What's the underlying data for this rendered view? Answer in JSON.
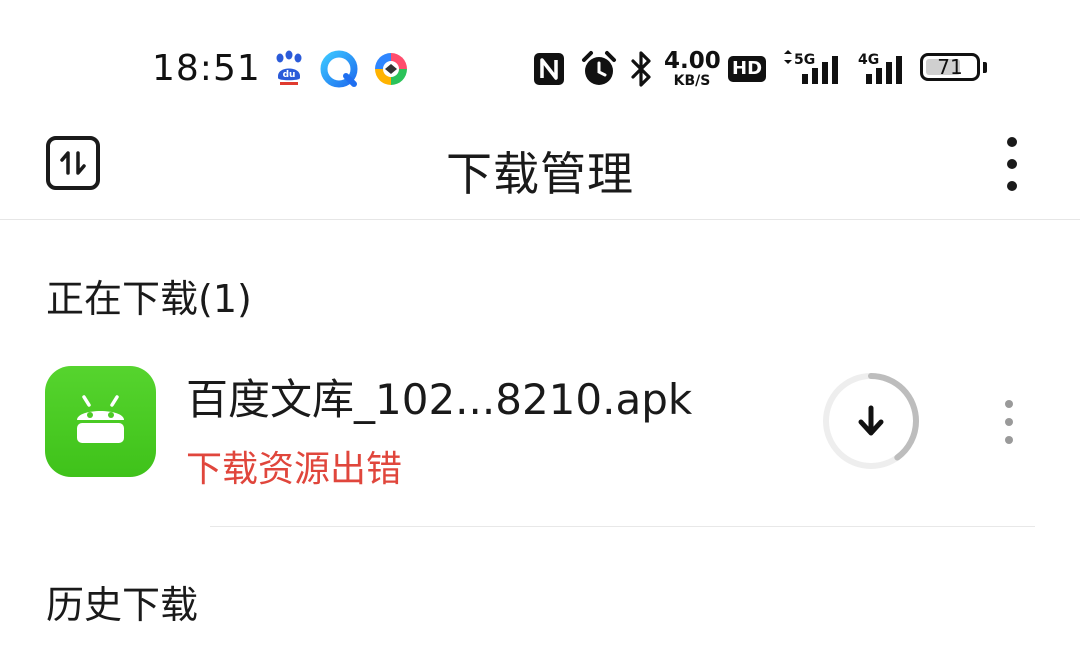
{
  "status_bar": {
    "time": "18:51",
    "speed_value": "4.00",
    "speed_unit": "KB/S",
    "hd_label": "HD",
    "signal_5g": "5G",
    "signal_4g": "4G",
    "battery": "71",
    "battery_level": 0.71,
    "icons": [
      "baidu-paw-icon",
      "browser-icon",
      "colorful-app-icon",
      "nfc-icon",
      "alarm-icon",
      "bluetooth-icon"
    ]
  },
  "app_bar": {
    "title": "下载管理",
    "left_icon": "sort-arrows-icon",
    "right_icon": "more-vert-icon"
  },
  "downloading": {
    "header": "正在下载(1)",
    "items": [
      {
        "file_name": "百度文库_102...8210.apk",
        "status": "下载资源出错",
        "progress": 0.4,
        "icon": "android-icon"
      }
    ]
  },
  "history": {
    "header": "历史下载"
  },
  "colors": {
    "accent_green": "#4CCB25",
    "error_red": "#E0463C",
    "text": "#1A1A1A"
  }
}
